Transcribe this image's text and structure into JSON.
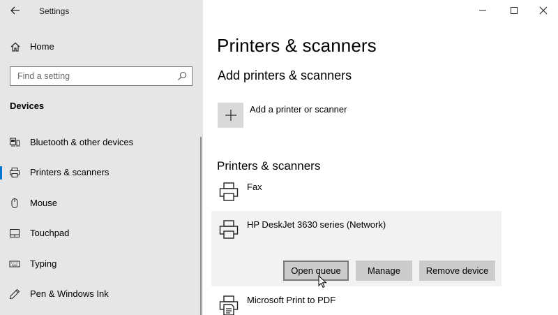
{
  "window": {
    "app_title": "Settings",
    "controls": {
      "minimize": "minimize",
      "maximize": "maximize",
      "close": "close"
    }
  },
  "sidebar": {
    "home_label": "Home",
    "search_placeholder": "Find a setting",
    "section_heading": "Devices",
    "items": [
      {
        "label": "Bluetooth & other devices",
        "icon": "bluetooth-devices-icon",
        "active": false
      },
      {
        "label": "Printers & scanners",
        "icon": "printer-icon",
        "active": true
      },
      {
        "label": "Mouse",
        "icon": "mouse-icon",
        "active": false
      },
      {
        "label": "Touchpad",
        "icon": "touchpad-icon",
        "active": false
      },
      {
        "label": "Typing",
        "icon": "keyboard-icon",
        "active": false
      },
      {
        "label": "Pen & Windows Ink",
        "icon": "pen-icon",
        "active": false
      }
    ]
  },
  "main": {
    "title": "Printers & scanners",
    "add_section": {
      "heading": "Add printers & scanners",
      "add_label": "Add a printer or scanner"
    },
    "list_section": {
      "heading": "Printers & scanners",
      "printers": [
        {
          "name": "Fax",
          "icon": "printer-icon"
        },
        {
          "name": "HP DeskJet 3630 series (Network)",
          "icon": "printer-icon",
          "selected": true
        },
        {
          "name": "Microsoft Print to PDF",
          "icon": "pdf-printer-icon"
        }
      ],
      "actions": {
        "open_queue": "Open queue",
        "manage": "Manage",
        "remove": "Remove device"
      }
    }
  },
  "colors": {
    "accent": "#0078d4",
    "sidebar_bg": "#e6e6e6",
    "selected_row_bg": "#f2f2f2",
    "button_bg": "#cccccc"
  }
}
